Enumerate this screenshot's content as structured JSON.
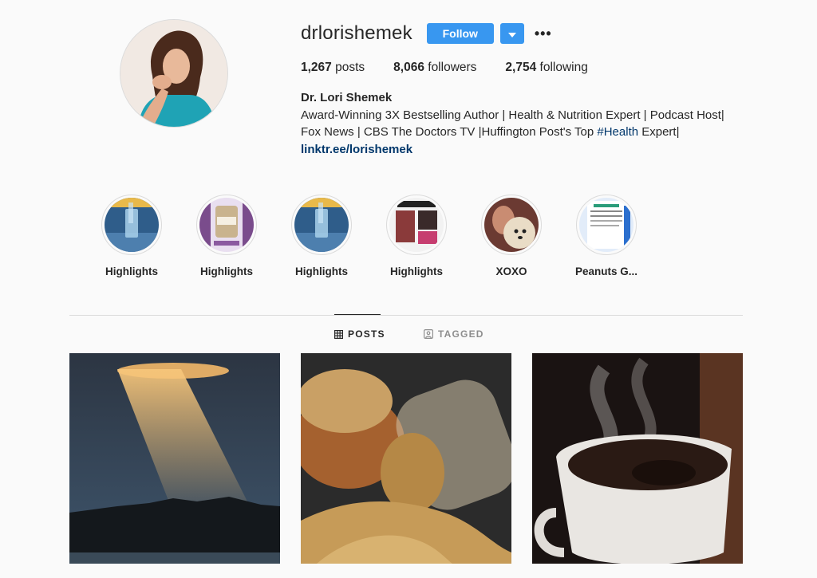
{
  "profile": {
    "username": "drlorishemek",
    "follow_label": "Follow",
    "more_label": "•••",
    "stats": {
      "posts_count": "1,267",
      "posts_label": " posts",
      "followers_count": "8,066",
      "followers_label": " followers",
      "following_count": "2,754",
      "following_label": " following"
    },
    "name": "Dr. Lori Shemek",
    "bio_line1": "Award-Winning 3X Bestselling Author | Health & Nutrition Expert | Podcast Host|",
    "bio_line2_pre": "Fox News | CBS The Doctors TV |Huffington Post's Top ",
    "bio_hashtag": "#Health",
    "bio_line2_post": " Expert|",
    "link": "linktr.ee/lorishemek"
  },
  "highlights": [
    {
      "label": "Highlights",
      "icon": "water-glass-image"
    },
    {
      "label": "Highlights",
      "icon": "supplement-image"
    },
    {
      "label": "Highlights",
      "icon": "water-glass-image"
    },
    {
      "label": "Highlights",
      "icon": "collage-image"
    },
    {
      "label": "XOXO",
      "icon": "dog-photo"
    },
    {
      "label": "Peanuts G...",
      "icon": "document-image"
    }
  ],
  "tabs": [
    {
      "label": "POSTS",
      "icon": "grid-icon",
      "active": true
    },
    {
      "label": "TAGGED",
      "icon": "tagged-icon",
      "active": false
    }
  ],
  "posts": [
    {
      "subject": "sun-rays-over-trees"
    },
    {
      "subject": "spilled-powder-jar"
    },
    {
      "subject": "steaming-coffee-cup"
    }
  ],
  "colors": {
    "accent": "#3897f0",
    "link": "#00376b",
    "background": "#fafafa"
  }
}
